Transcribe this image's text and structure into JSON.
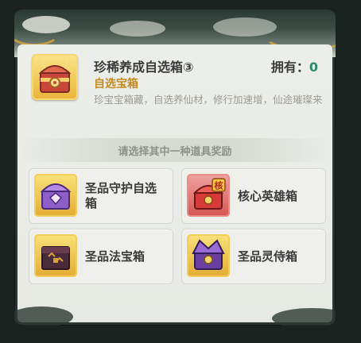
{
  "item": {
    "name": "珍稀养成自选箱③",
    "type": "自选宝箱",
    "description": "珍宝宝箱藏，自选养仙材，修行加速增，仙途璀璨来",
    "owned_label": "拥有：",
    "owned_value": "0",
    "icon": "ornate-red-gold-chest-icon"
  },
  "prompt": "请选择其中一种道具奖励",
  "options": [
    {
      "label": "圣品守护自选箱",
      "icon": "purple-guardian-chest-icon"
    },
    {
      "label": "核心英雄箱",
      "icon": "red-hero-chest-icon",
      "badge": "核"
    },
    {
      "label": "圣品法宝箱",
      "icon": "dark-treasure-chest-icon"
    },
    {
      "label": "圣品灵侍箱",
      "icon": "purple-spirit-chest-icon"
    }
  ],
  "colors": {
    "owned_value": "#2f8a6c",
    "item_type": "#c38a1d",
    "gold_frame": "#e8b438",
    "red_frame": "#d5554f"
  }
}
